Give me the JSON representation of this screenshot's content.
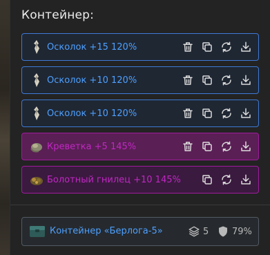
{
  "header": {
    "title": "Контейнер:"
  },
  "items": [
    {
      "label": "Осколок +15 120%",
      "rarity": "blue",
      "icon": "shard-icon"
    },
    {
      "label": "Осколок +10 120%",
      "rarity": "blue",
      "icon": "shard-icon"
    },
    {
      "label": "Осколок +10 120%",
      "rarity": "blue",
      "icon": "shard-icon"
    },
    {
      "label": "Креветка +5 145%",
      "rarity": "magenta",
      "icon": "shrimp-icon"
    },
    {
      "label": "Болотный гнилец +10 145%",
      "rarity": "magenta",
      "icon": "swamp-rot-icon"
    }
  ],
  "actions": [
    "trash-icon",
    "copy-icon",
    "refresh-icon",
    "download-icon"
  ],
  "container": {
    "name": "Контейнер «Берлога-5»",
    "stack_count": "5",
    "durability": "79%",
    "icon": "container-box-icon"
  },
  "colors": {
    "blue_border": "#3e7ad6",
    "blue_text": "#4ea0ff",
    "magenta_border": "#a11aa0",
    "magenta_text": "#c028c3",
    "panel_bg": "#232323"
  }
}
